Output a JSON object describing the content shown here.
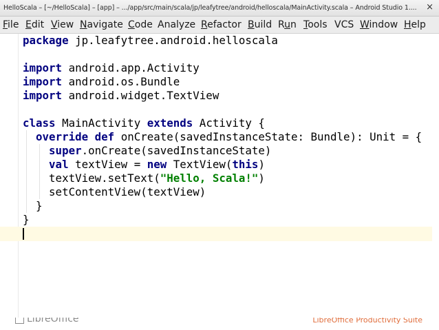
{
  "window": {
    "title": "HelloScala – [~/HelloScala] – [app] – .../app/src/main/scala/jp/leafytree/android/helloscala/MainActivity.scala – Android Studio 1....",
    "close_glyph": "×"
  },
  "menu": [
    {
      "label": "File",
      "mnemonic": "F",
      "rest": "ile"
    },
    {
      "label": "Edit",
      "mnemonic": "E",
      "rest": "dit"
    },
    {
      "label": "View",
      "mnemonic": "V",
      "rest": "iew"
    },
    {
      "label": "Navigate",
      "mnemonic": "N",
      "rest": "avigate"
    },
    {
      "label": "Code",
      "mnemonic": "C",
      "rest": "ode"
    },
    {
      "label": "Analyze",
      "mnemonic": "",
      "rest": "Analyze"
    },
    {
      "label": "Refactor",
      "mnemonic": "R",
      "rest": "efactor"
    },
    {
      "label": "Build",
      "mnemonic": "B",
      "rest": "uild"
    },
    {
      "label": "Run",
      "pre": "R",
      "mnemonic": "u",
      "rest": "n"
    },
    {
      "label": "Tools",
      "mnemonic": "T",
      "rest": "ools"
    },
    {
      "label": "VCS",
      "mnemonic": "",
      "rest": "VCS"
    },
    {
      "label": "Window",
      "mnemonic": "W",
      "rest": "indow"
    },
    {
      "label": "Help",
      "mnemonic": "H",
      "rest": "elp"
    }
  ],
  "editor": {
    "lines": [
      [
        {
          "t": "package",
          "k": "kw"
        },
        {
          "t": " jp.leafytree.android.helloscala"
        }
      ],
      [],
      [
        {
          "t": "import",
          "k": "kw"
        },
        {
          "t": " android.app.Activity"
        }
      ],
      [
        {
          "t": "import",
          "k": "kw"
        },
        {
          "t": " android.os.Bundle"
        }
      ],
      [
        {
          "t": "import",
          "k": "kw"
        },
        {
          "t": " android.widget.TextView"
        }
      ],
      [],
      [
        {
          "t": "class",
          "k": "kw"
        },
        {
          "t": " MainActivity "
        },
        {
          "t": "extends",
          "k": "kw"
        },
        {
          "t": " Activity {"
        }
      ],
      [
        {
          "t": "  "
        },
        {
          "t": "override",
          "k": "kw"
        },
        {
          "t": " "
        },
        {
          "t": "def",
          "k": "kw"
        },
        {
          "t": " onCreate(savedInstanceState: Bundle): Unit = {"
        }
      ],
      [
        {
          "t": "    "
        },
        {
          "t": "super",
          "k": "kw"
        },
        {
          "t": ".onCreate(savedInstanceState)"
        }
      ],
      [
        {
          "t": "    "
        },
        {
          "t": "val",
          "k": "kw"
        },
        {
          "t": " textView = "
        },
        {
          "t": "new",
          "k": "kw"
        },
        {
          "t": " TextView("
        },
        {
          "t": "this",
          "k": "kw"
        },
        {
          "t": ")"
        }
      ],
      [
        {
          "t": "    textView.setText("
        },
        {
          "t": "\"Hello, Scala!\"",
          "k": "str"
        },
        {
          "t": ")"
        }
      ],
      [
        {
          "t": "    setContentView(textView)"
        }
      ],
      [
        {
          "t": "  }"
        }
      ],
      [
        {
          "t": "}"
        }
      ],
      []
    ]
  },
  "footer": {
    "logo": "LibreOffice",
    "suite": "LibreOffice Productivity Suite"
  },
  "colors": {
    "keyword": "#000080",
    "string": "#008000",
    "caret_row": "#fffae3"
  }
}
